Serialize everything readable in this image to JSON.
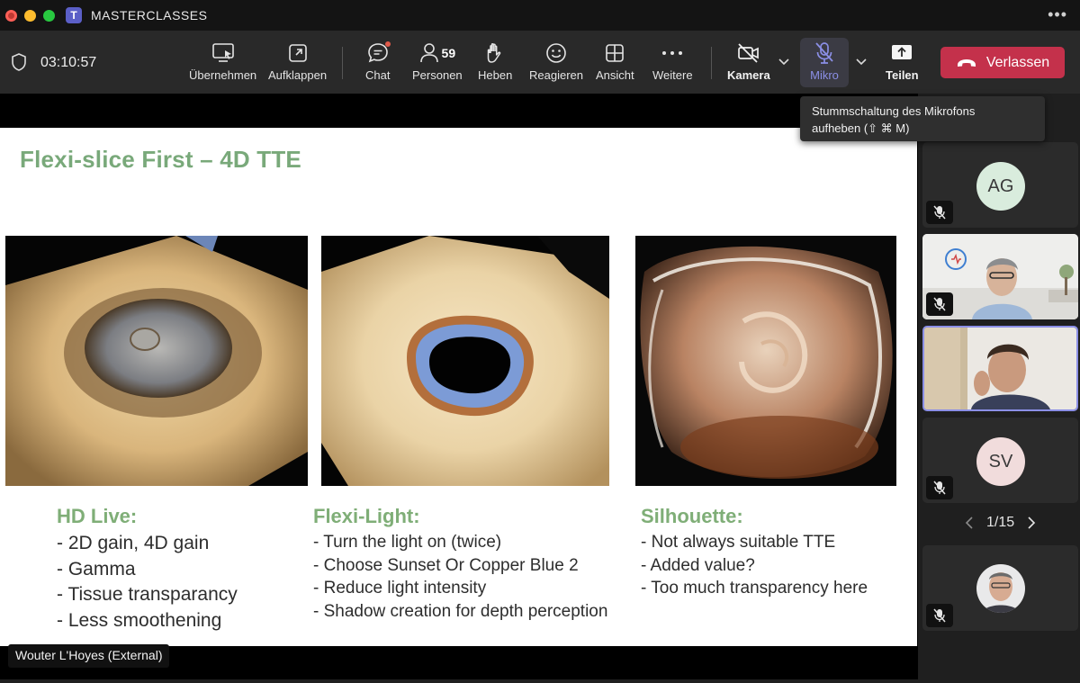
{
  "window": {
    "app_title": "MASTERCLASSES",
    "more": "•••"
  },
  "toolbar": {
    "timer": "03:10:57",
    "buttons": {
      "takeover": "Übernehmen",
      "popout": "Aufklappen",
      "chat": "Chat",
      "people": "Personen",
      "people_count": "59",
      "raise": "Heben",
      "react": "Reagieren",
      "view": "Ansicht",
      "more": "Weitere",
      "camera": "Kamera",
      "mic": "Mikro",
      "share": "Teilen",
      "leave": "Verlassen"
    },
    "colors": {
      "leave": "#c4314b",
      "mic_active": "#8b8fe6"
    }
  },
  "tooltip": {
    "line1": "Stummschaltung des Mikrofons",
    "line2": "aufheben (⇧ ⌘ M)"
  },
  "slide": {
    "title": "Flexi-slice First – 4D TTE",
    "columns": [
      {
        "heading": "HD Live:",
        "items": [
          "- 2D gain, 4D gain",
          "- Gamma",
          "- Tissue transparancy",
          "- Less smoothening"
        ]
      },
      {
        "heading": "Flexi-Light:",
        "items": [
          "- Turn the light on (twice)",
          "- Choose Sunset Or Copper Blue 2",
          "- Reduce light intensity",
          "- Shadow creation for depth perception"
        ]
      },
      {
        "heading": "Silhouette:",
        "items": [
          "- Not always suitable TTE",
          "- Added value?",
          "- Too much transparency here"
        ]
      }
    ],
    "colors": {
      "heading": "#7fae77"
    }
  },
  "presenter": {
    "name": "Wouter L'Hoyes (External)"
  },
  "participants": {
    "tiles": [
      {
        "initials": "AG",
        "avatar_color": "#d9ecdd"
      },
      {
        "initials": ""
      },
      {
        "initials": ""
      },
      {
        "initials": "SV",
        "avatar_color": "#f1dcdc"
      },
      {
        "initials": ""
      }
    ],
    "pager": "1/15"
  }
}
